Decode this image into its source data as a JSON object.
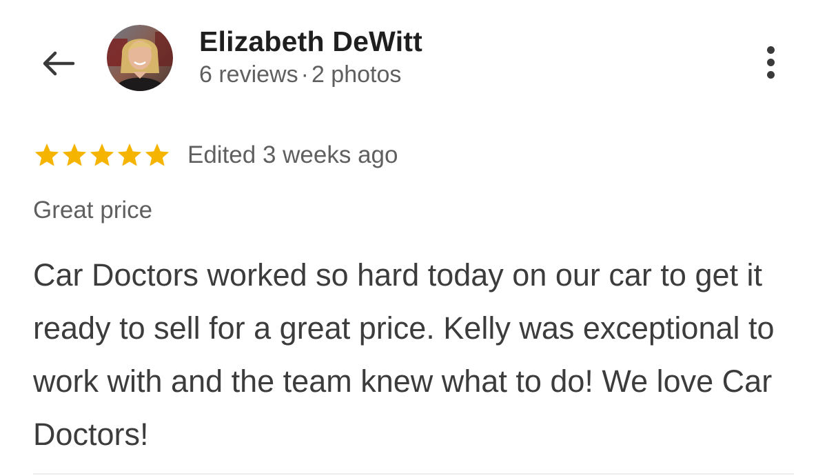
{
  "header": {
    "back_icon": "arrow-left-icon",
    "avatar_alt": "Elizabeth DeWitt profile photo",
    "reviewer_name": "Elizabeth DeWitt",
    "reviews_count": "6 reviews",
    "separator": "·",
    "photos_count": "2 photos",
    "menu_icon": "more-vert-icon"
  },
  "review": {
    "rating": 5,
    "rating_max": 5,
    "star_color": "#f4b400",
    "edited": "Edited 3 weeks ago",
    "tag": "Great price",
    "text": "Car Doctors worked so hard today on our car to get it ready to sell for a great price. Kelly was exceptional to work with and the team knew what to do! We love Car Doctors!"
  }
}
